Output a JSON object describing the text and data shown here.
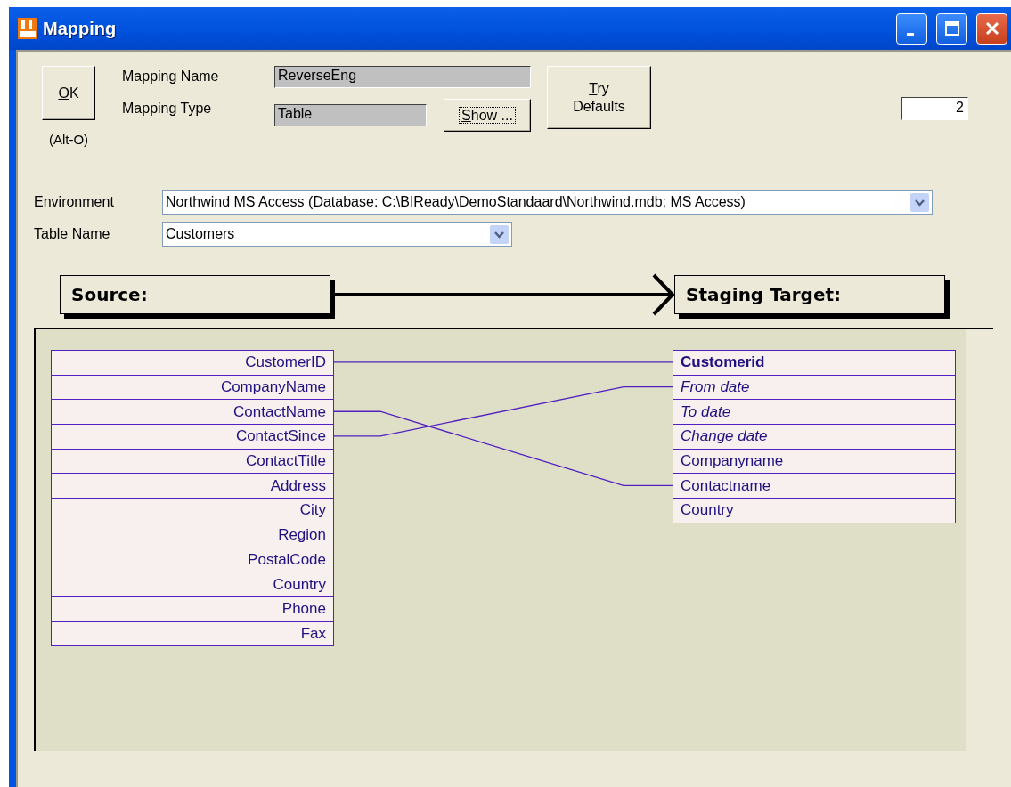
{
  "window": {
    "title": "Mapping"
  },
  "ok_button": {
    "label": "OK",
    "hint": "(Alt-O)"
  },
  "mapping_name": {
    "label": "Mapping Name",
    "value": "ReverseEng"
  },
  "mapping_type": {
    "label": "Mapping Type",
    "value": "Table"
  },
  "show_button": {
    "label": "Show ...",
    "focused": true
  },
  "try_defaults_button": {
    "label": "Try Defaults"
  },
  "counter": {
    "value": "2"
  },
  "environment": {
    "label": "Environment",
    "value": "Northwind MS Access (Database: C:\\BIReady\\DemoStandaard\\Northwind.mdb;  MS Access)"
  },
  "table_name": {
    "label": "Table Name",
    "value": "Customers"
  },
  "source_header": "Source:",
  "target_header": "Staging Target:",
  "source_fields": [
    {
      "name": "CustomerID"
    },
    {
      "name": "CompanyName"
    },
    {
      "name": "ContactName"
    },
    {
      "name": "ContactSince"
    },
    {
      "name": "ContactTitle"
    },
    {
      "name": "Address"
    },
    {
      "name": "City"
    },
    {
      "name": "Region"
    },
    {
      "name": "PostalCode"
    },
    {
      "name": "Country"
    },
    {
      "name": "Phone"
    },
    {
      "name": "Fax"
    }
  ],
  "target_fields": [
    {
      "name": "Customerid",
      "kind": "key"
    },
    {
      "name": "From date",
      "kind": "date"
    },
    {
      "name": "To date",
      "kind": "date"
    },
    {
      "name": "Change date",
      "kind": "date"
    },
    {
      "name": "Companyname",
      "kind": "plain"
    },
    {
      "name": "Contactname",
      "kind": "plain"
    },
    {
      "name": "Country",
      "kind": "plain"
    }
  ]
}
